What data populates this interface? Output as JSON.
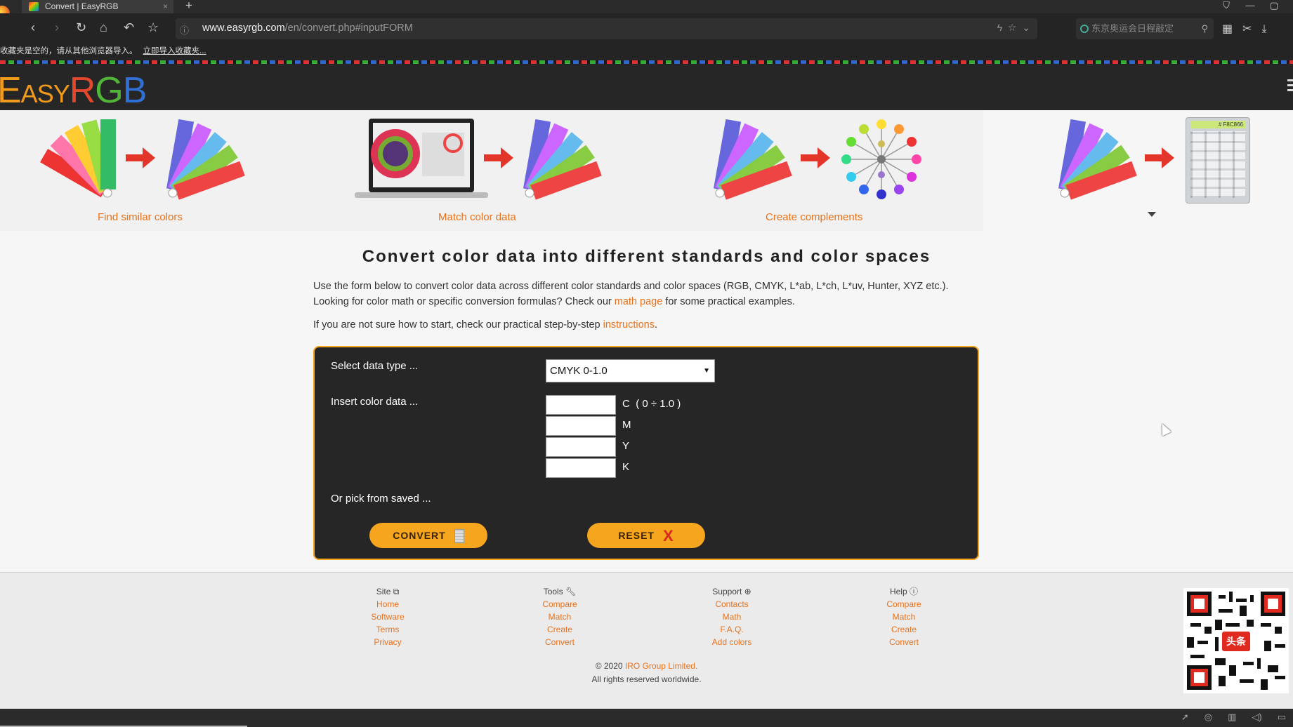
{
  "browser": {
    "tab_title": "Convert | EasyRGB",
    "tab_close": "×",
    "new_tab": "+",
    "url_host": "www.easyrgb.com",
    "url_path": "/en/convert.php#inputFORM",
    "search_placeholder": "东京奥运会日程敲定",
    "bookmark_notice": "收藏夹是空的，请从其他浏览器导入。",
    "bookmark_link": "立即导入收藏夹..."
  },
  "site": {
    "logo_easy": "Easy",
    "logo_r": "R",
    "logo_g": "G",
    "logo_b": "B"
  },
  "features": [
    {
      "label": "Find similar colors"
    },
    {
      "label": "Match color data"
    },
    {
      "label": "Create complements"
    }
  ],
  "calculator_display": "# F8C866",
  "main": {
    "title": "Convert color data into different standards and color spaces",
    "intro_line1": "Use the form below to convert color data across different color standards and color spaces (RGB, CMYK, L*ab, L*ch, L*uv, Hunter, XYZ etc.).",
    "intro_line2_pre": "Looking for color math or specific conversion formulas? Check our ",
    "intro_link": "math page",
    "intro_line2_post": " for some practical examples.",
    "hint_pre": "If you are not sure how to start, check our practical step-by-step ",
    "hint_link": "instructions",
    "hint_post": "."
  },
  "form": {
    "select_label": "Select data type ...",
    "select_value": "CMYK 0-1.0",
    "insert_label": "Insert color data ...",
    "fields": [
      {
        "name": "C",
        "range": "( 0 ÷ 1.0 )",
        "value": ""
      },
      {
        "name": "M",
        "range": "",
        "value": ""
      },
      {
        "name": "Y",
        "range": "",
        "value": ""
      },
      {
        "name": "K",
        "range": "",
        "value": ""
      }
    ],
    "saved_label": "Or pick from saved ...",
    "convert_label": "CONVERT",
    "reset_label": "RESET",
    "reset_icon": "X"
  },
  "footer": {
    "columns": [
      {
        "heading": "Site",
        "icon": "external-link-icon",
        "links": [
          "Home",
          "Software",
          "Terms",
          "Privacy"
        ]
      },
      {
        "heading": "Tools",
        "icon": "wrench-icon",
        "links": [
          "Compare",
          "Match",
          "Create",
          "Convert"
        ]
      },
      {
        "heading": "Support",
        "icon": "lifebuoy-icon",
        "links": [
          "Contacts",
          "Math",
          "F.A.Q.",
          "Add colors"
        ]
      },
      {
        "heading": "Help",
        "icon": "question-icon",
        "links": [
          "Compare",
          "Match",
          "Create",
          "Convert"
        ]
      }
    ],
    "copyright_pre": "© 2020 ",
    "copyright_link": "IRO Group Limited.",
    "rights": "All rights reserved worldwide.",
    "qr_badge": "头条"
  },
  "colors": {
    "accent": "#e8721c",
    "button": "#f5a51e",
    "dark": "#262626"
  }
}
